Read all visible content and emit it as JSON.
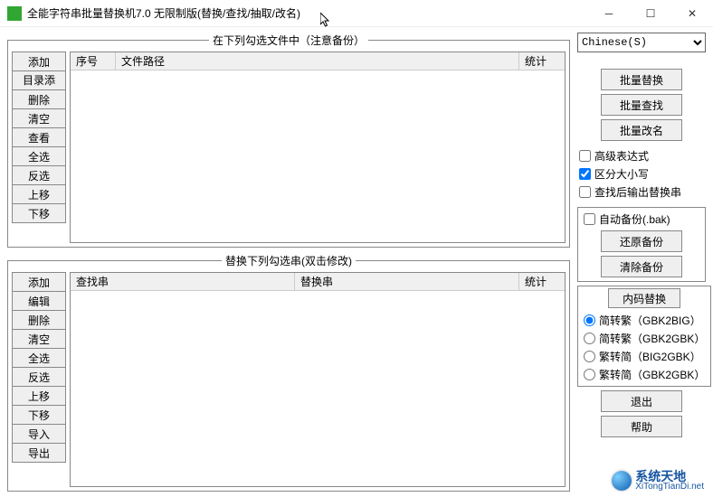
{
  "window": {
    "title": "全能字符串批量替换机7.0 无限制版(替换/查找/抽取/改名)"
  },
  "groupbox": {
    "files_legend": "在下列勾选文件中（注意备份）",
    "strings_legend": "替换下列勾选串(双击修改)"
  },
  "file_buttons": [
    "添加",
    "目录添加",
    "删除",
    "清空",
    "查看",
    "全选",
    "反选",
    "上移",
    "下移"
  ],
  "file_columns": {
    "seq": "序号",
    "path": "文件路径",
    "stat": "统计"
  },
  "str_buttons": [
    "添加",
    "编辑",
    "删除",
    "清空",
    "全选",
    "反选",
    "上移",
    "下移",
    "导入",
    "导出"
  ],
  "str_columns": {
    "find": "查找串",
    "replace": "替换串",
    "stat": "统计"
  },
  "right": {
    "language_value": "Chinese(S)",
    "batch_replace": "批量替换",
    "batch_find": "批量查找",
    "batch_rename": "批量改名",
    "adv_expr": "高级表达式",
    "case_sensitive": "区分大小写",
    "output_after_find": "查找后输出替换串",
    "auto_backup": "自动备份(.bak)",
    "restore_backup": "还原备份",
    "clear_backup": "清除备份",
    "encode_legend": "内码替换",
    "enc_s2t_gbk2big": "简转繁（GBK2BIG）",
    "enc_s2t_gbk2gbk": "简转繁（GBK2GBK）",
    "enc_t2s_big2gbk": "繁转简（BIG2GBK）",
    "enc_t2s_gbk2gbk": "繁转简（GBK2GBK）",
    "exit": "退出",
    "help": "帮助"
  },
  "watermark": {
    "cn": "系统天地",
    "url": "XiTongTianDi.net"
  }
}
